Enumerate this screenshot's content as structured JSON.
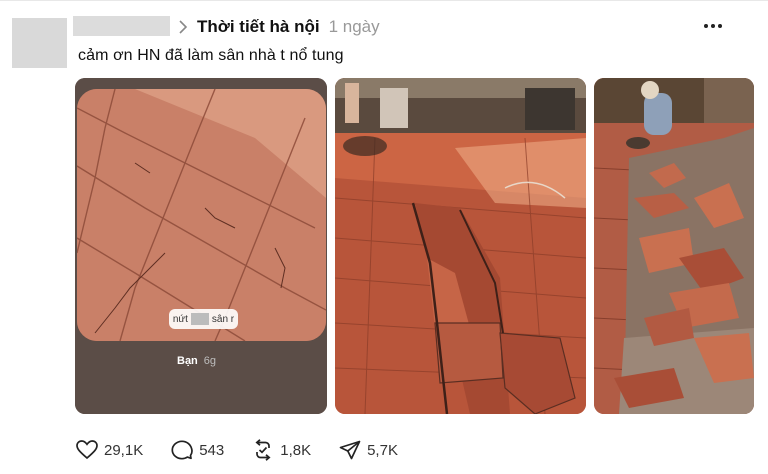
{
  "post": {
    "community": "Thời tiết hà nội",
    "time": "1 ngày",
    "text": "cảm ơn HN đã làm sân nhà t nổ tung"
  },
  "media": [
    {
      "name": "cracked-tiles-story",
      "story_label_before": "nứt",
      "story_label_after": "sân r",
      "viewer_label": "Bạn",
      "viewer_time": "6g"
    },
    {
      "name": "buckled-tiles-photo"
    },
    {
      "name": "broken-tiles-pile-photo"
    }
  ],
  "actions": {
    "likes": "29,1K",
    "comments": "543",
    "reposts": "1,8K",
    "shares": "5,7K"
  },
  "icons": [
    "heart-icon",
    "comment-icon",
    "repost-icon",
    "share-icon",
    "more-icon",
    "chevron-right-icon"
  ]
}
